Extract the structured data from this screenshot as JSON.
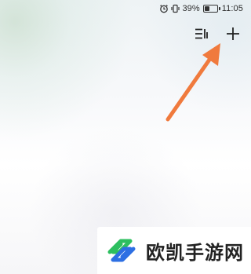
{
  "status_bar": {
    "battery_percent": "39%",
    "time": "11:05",
    "icons": [
      "alarm-icon",
      "vibrate-icon",
      "battery-icon"
    ]
  },
  "toolbar": {
    "icons": [
      "list-view-icon",
      "add-icon"
    ]
  },
  "annotation": {
    "color": "#f07a3d",
    "icon": "arrow-icon"
  },
  "watermark": {
    "text": "欧凯手游网",
    "logo_colors": [
      "#2dbf5f",
      "#2d6fe3"
    ]
  },
  "colors": {
    "background": "#f4f5f7",
    "icon_color": "#333333"
  }
}
